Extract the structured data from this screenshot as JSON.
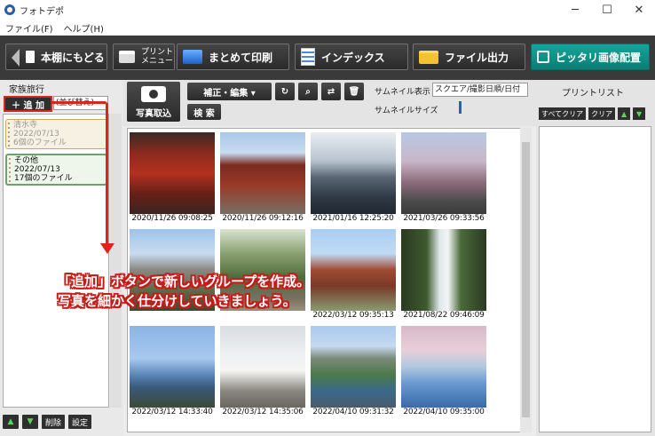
{
  "window": {
    "title": "フォトデポ",
    "controls": [
      "─",
      "☐",
      "✕"
    ]
  },
  "menu": {
    "items": [
      "ファイル(F)",
      "ヘルプ(H)"
    ]
  },
  "toolbar": {
    "back": "本棚にもどる",
    "print_menu_line1": "プリント",
    "print_menu_line2": "メニュー",
    "batch_print": "まとめて印刷",
    "index": "インデックス",
    "export": "ファイル出力",
    "fit": "ピッタリ画像配置",
    "fit_color": "#0c8f86"
  },
  "left": {
    "group_name": "家族旅行",
    "add_button": "＋ 追 加",
    "sort_select": "(並び替え)",
    "groups": [
      {
        "name": "清水寺",
        "date": "2022/07/13",
        "count": "6個のファイル"
      },
      {
        "name": "その他",
        "date": "2022/07/13",
        "count": "17個のファイル"
      }
    ],
    "delete_button": "削除",
    "settings_button": "設定"
  },
  "main": {
    "import_button": "写真取込",
    "edit_button": "補正・編集 ▾",
    "search_button": "検 索",
    "thumb_label": "サムネイル表示",
    "thumb_select": "スクエア/撮影日順/日付",
    "size_label": "サムネイルサイズ",
    "photos": [
      {
        "dt": "2020/11/26 09:08:25",
        "scene": "temple-red"
      },
      {
        "dt": "2020/11/26 09:12:16",
        "scene": "temple-gate"
      },
      {
        "dt": "2021/01/16 12:25:20",
        "scene": "sea"
      },
      {
        "dt": "2021/03/26 09:33:56",
        "scene": "blossom"
      },
      {
        "dt": "",
        "scene": "castle"
      },
      {
        "dt": "",
        "scene": "garden"
      },
      {
        "dt": "2022/03/12 09:35:13",
        "scene": "pagoda"
      },
      {
        "dt": "2021/08/22 09:46:09",
        "scene": "waterfall"
      },
      {
        "dt": "2022/03/12 14:33:40",
        "scene": "coast"
      },
      {
        "dt": "2022/03/12 14:35:06",
        "scene": "monument"
      },
      {
        "dt": "2022/04/10 09:31:32",
        "scene": "field"
      },
      {
        "dt": "2022/04/10 09:35:00",
        "scene": "flowers"
      }
    ]
  },
  "right": {
    "title": "プリントリスト",
    "clear_all": "すべてクリア",
    "clear": "クリア"
  },
  "callout": {
    "line1": "「追加」ボタンで新しいグループを作成。",
    "line2": "写真を細かく仕分けしていきましょう。",
    "color": "#e0231d"
  }
}
